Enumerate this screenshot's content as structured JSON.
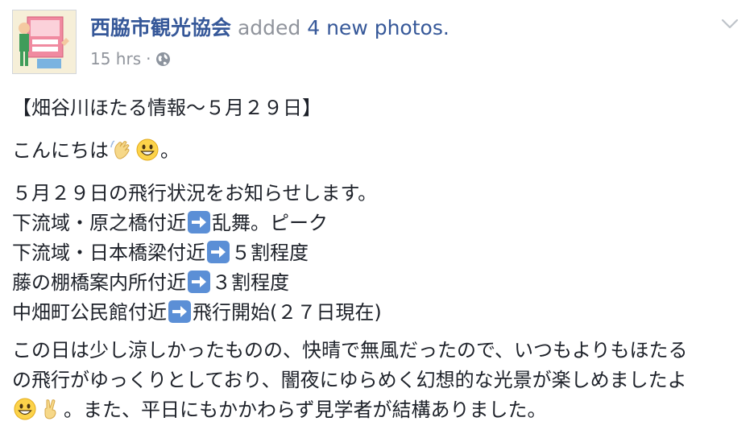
{
  "post": {
    "author": "西脇市観光協会",
    "action": "added",
    "action_object": "4 new photos.",
    "timestamp": "15 hrs",
    "separator": "·",
    "privacy_icon": "globe-icon",
    "menu_icon": "chevron-down-icon"
  },
  "body": {
    "title": "【畑谷川ほたる情報〜５月２９日】",
    "greeting_text": "こんにちは",
    "greeting_end": "。",
    "intro": "５月２９日の飛行状況をお知らせします。",
    "locations": [
      {
        "place": "下流域・原之橋付近",
        "status": "乱舞。ピーク"
      },
      {
        "place": "下流域・日本橋梁付近",
        "status": "５割程度"
      },
      {
        "place": "藤の棚橋案内所付近",
        "status": "３割程度"
      },
      {
        "place": "中畑町公民館付近",
        "status": "飛行開始(２７日現在)"
      }
    ],
    "closing_line1": "この日は少し涼しかったものの、快晴で無風だったので、いつもよりもほたる",
    "closing_line2": "の飛行がゆっくりとしており、闇夜にゆらめく幻想的な光景が楽しめましたよ",
    "closing_line3": "。また、平日にもかかわらず見学者が結構ありました。"
  },
  "icons": {
    "wave": "waving-hand-icon",
    "smile": "smiley-icon",
    "arrow": "right-arrow-icon",
    "victory": "victory-hand-icon"
  }
}
